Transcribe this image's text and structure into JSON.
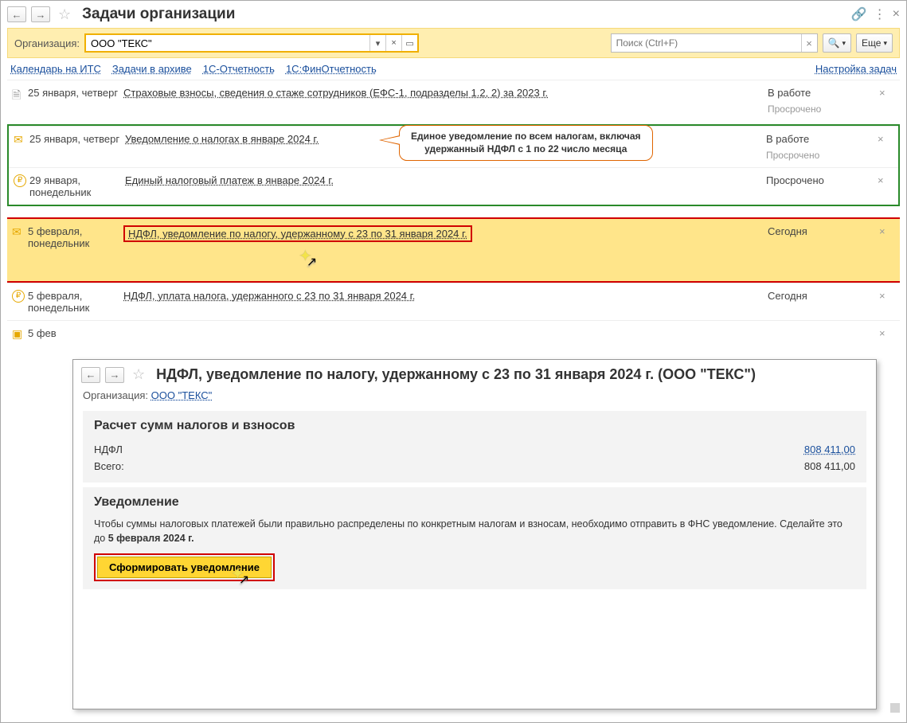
{
  "header": {
    "title": "Задачи организации"
  },
  "toolbar": {
    "org_label": "Организация:",
    "org_value": "ООО \"ТЕКС\"",
    "search_placeholder": "Поиск (Ctrl+F)",
    "more_label": "Еще"
  },
  "links": {
    "cal": "Календарь на ИТС",
    "archive": "Задачи в архиве",
    "rep1c": "1С-Отчетность",
    "fin": "1С:ФинОтчетность",
    "settings": "Настройка задач"
  },
  "callout": {
    "l1": "Единое уведомление по всем налогам, включая",
    "l2": "удержанный НДФЛ с 1 по 22 число месяца"
  },
  "tasks": [
    {
      "icon": "doc",
      "date": "25 января, четверг",
      "title": "Страховые взносы, сведения о стаже сотрудников (ЕФС-1, подразделы 1.2, 2) за 2023 г.",
      "status": "В работе",
      "sub": "Просрочено"
    },
    {
      "icon": "env",
      "date": "25 января, четверг",
      "title": "Уведомление о налогах в январе 2024 г.",
      "status": "В работе",
      "sub": "Просрочено"
    },
    {
      "icon": "rub",
      "date": "29 января, понедельник",
      "title": "Единый налоговый платеж в январе 2024 г.",
      "status": "Просрочено",
      "statClass": "over"
    },
    {
      "icon": "env",
      "date": "5 февраля, понедельник",
      "title": "НДФЛ, уведомление по налогу, удержанному с 23 по 31 января 2024 г.",
      "status": "Сегодня",
      "statClass": "today",
      "hl": true
    },
    {
      "icon": "rub",
      "date": "5 февраля, понедельник",
      "title": "НДФЛ, уплата налога, удержанного с 23 по 31 января 2024 г.",
      "status": "Сегодня",
      "statClass": "today"
    },
    {
      "icon": "box",
      "date": "5 фев",
      "title": "",
      "status": ""
    }
  ],
  "detail": {
    "title": "НДФЛ, уведомление по налогу, удержанному с 23 по 31 января 2024 г. (ООО \"ТЕКС\")",
    "org_label": "Организация:",
    "org_link": "ООО \"ТЕКС\"",
    "panel1_title": "Расчет сумм налогов и взносов",
    "row1_name": "НДФЛ",
    "row1_val": "808 411,00",
    "row2_name": "Всего:",
    "row2_val": "808 411,00",
    "panel2_title": "Уведомление",
    "panel2_desc_a": "Чтобы суммы налоговых платежей были правильно распределены по конкретным налогам и взносам, необходимо отправить в ФНС уведомление. Сделайте это до ",
    "panel2_desc_b": "5 февраля 2024 г.",
    "btn": "Сформировать уведомление"
  }
}
